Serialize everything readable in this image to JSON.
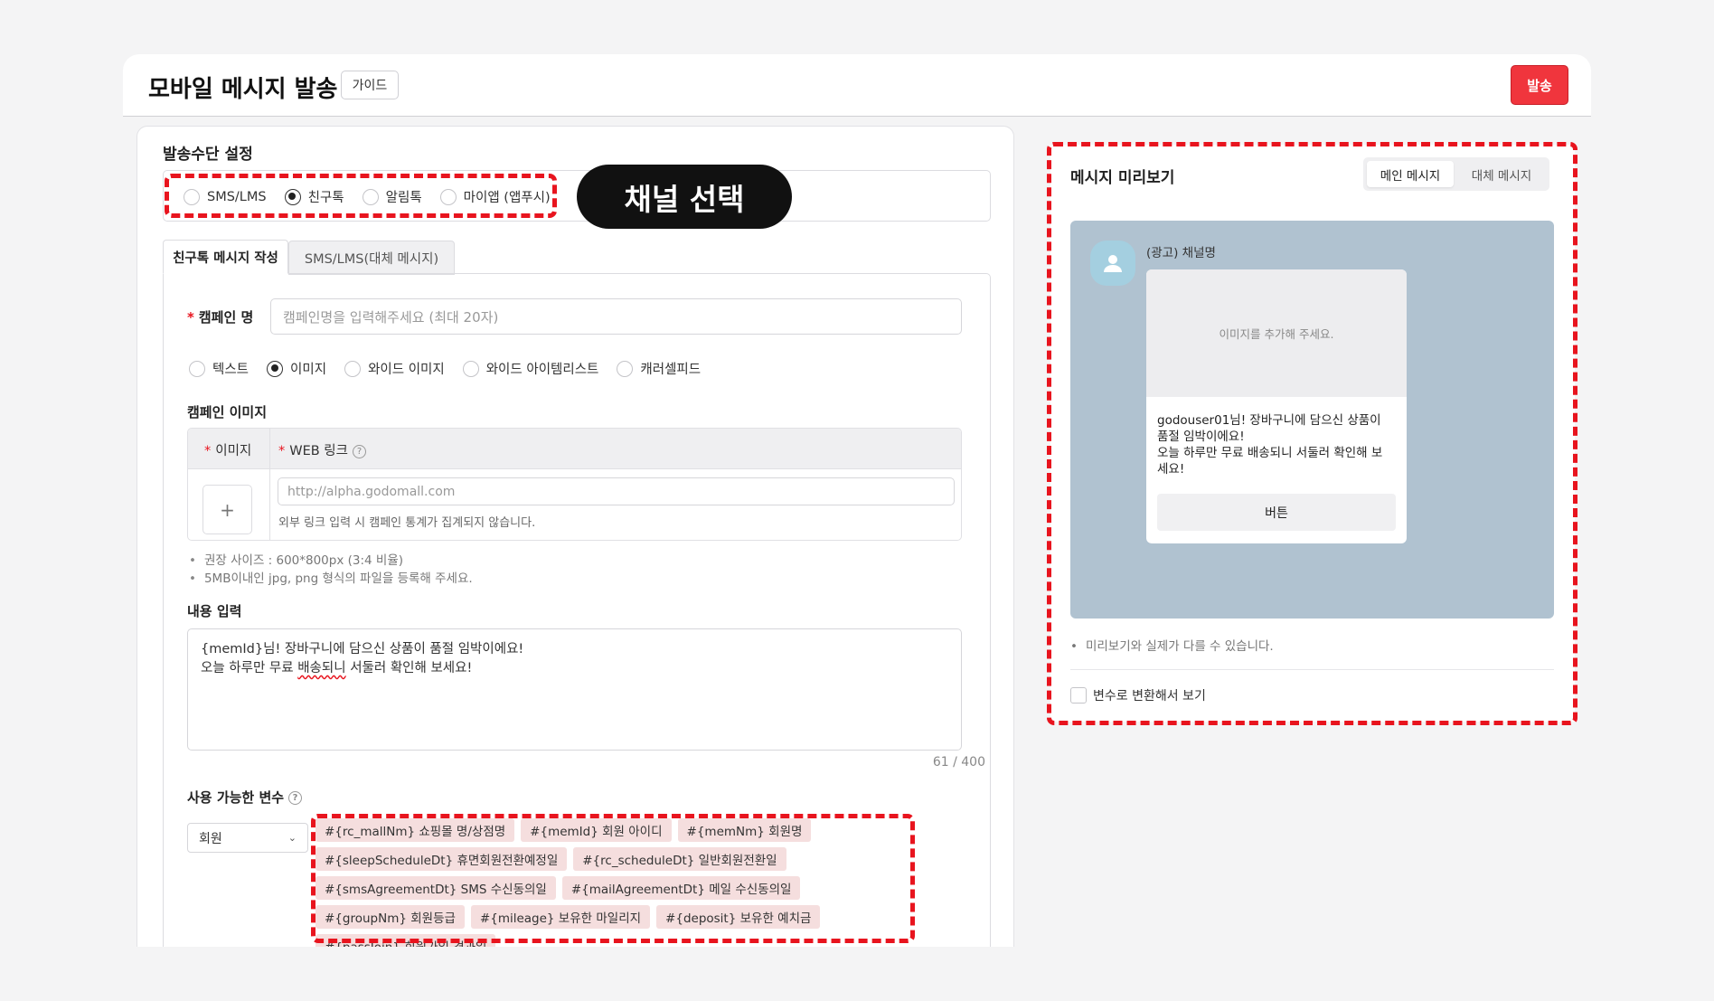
{
  "header": {
    "title": "모바일 메시지 발송",
    "guide_label": "가이드",
    "send_label": "발송"
  },
  "send_settings": {
    "title": "발송수단 설정",
    "channels": [
      "SMS/LMS",
      "친구톡",
      "알림톡",
      "마이앱 (앱푸시)"
    ],
    "selected_channel": "친구톡"
  },
  "annotation": {
    "label": "채널 선택"
  },
  "tabs": [
    "친구톡 메시지 작성",
    "SMS/LMS(대체 메시지)"
  ],
  "form": {
    "campaign_name_label": "캠페인 명",
    "campaign_name_placeholder": "캠페인명을 입력해주세요 (최대 20자)",
    "message_types": [
      "텍스트",
      "이미지",
      "와이드 이미지",
      "와이드 아이템리스트",
      "캐러셀피드"
    ],
    "selected_type": "이미지",
    "campaign_image_label": "캠페인 이미지",
    "col_image": "이미지",
    "col_web_link": "WEB 링크",
    "web_link_placeholder": "http://alpha.godomall.com",
    "web_link_note": "외부 링크 입력 시 캠페인 통계가 집계되지 않습니다.",
    "plus": "+",
    "notes": [
      "권장 사이즈 : 600*800px (3:4 비율)",
      "5MB이내인 jpg, png 형식의 파일을 등록해 주세요."
    ],
    "content_label": "내용 입력",
    "content_line1": "{memId}님! 장바구니에 담으신 상품이 품절 임박이에요!",
    "content_line2_pre": "오늘 하루만 무료 ",
    "content_line2_typo": "배송되니",
    "content_line2_post": " 서둘러 확인해 보세요!",
    "counter": "61 / 400",
    "variables_label": "사용 가능한 변수",
    "variable_select": "회원",
    "variables": [
      "#{rc_mallNm} 쇼핑몰 명/상점명",
      "#{memId} 회원 아이디",
      "#{memNm} 회원명",
      "#{sleepScheduleDt} 휴면회원전환예정일",
      "#{rc_scheduleDt} 일반회원전환일",
      "#{smsAgreementDt} SMS 수신동의일",
      "#{mailAgreementDt} 메일 수신동의일",
      "#{groupNm} 회원등급",
      "#{mileage} 보유한 마일리지",
      "#{deposit} 보유한 예치금",
      "#{passJoin} 회원가입 경과일"
    ]
  },
  "preview": {
    "title": "메시지 미리보기",
    "seg_main": "메인 메시지",
    "seg_alt": "대체 메시지",
    "channel_name": "(광고) 채널명",
    "image_placeholder": "이미지를 추가해 주세요.",
    "body_line1": "godouser01님! 장바구니에 담으신 상품이",
    "body_line2": "품절 임박이에요!",
    "body_line3": "오늘 하루만 무료 배송되니 서둘러 확인해 보",
    "body_line4": "세요!",
    "button_label": "버튼",
    "note": "미리보기와 실제가 다를 수 있습니다.",
    "checkbox_label": "변수로 변환해서 보기"
  },
  "colors": {
    "accent_red": "#f0353d",
    "annotation_red": "#e8141e",
    "preview_bg": "#b0c2d0",
    "chip_bg": "#f5dede"
  }
}
